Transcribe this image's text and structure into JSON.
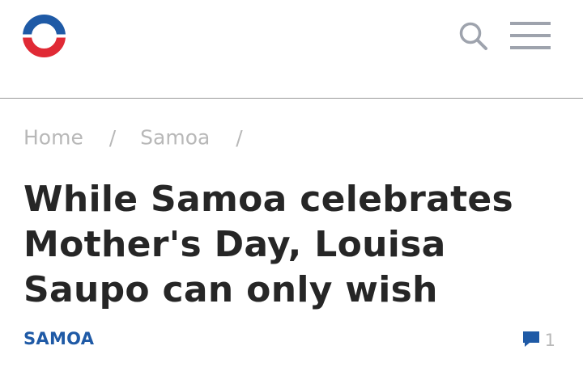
{
  "header": {
    "logo_icon": "circle-logo-icon",
    "search_icon": "search-icon",
    "menu_icon": "hamburger-menu-icon"
  },
  "breadcrumb": {
    "items": [
      "Home",
      "Samoa"
    ],
    "separator": "/"
  },
  "article": {
    "title": "While Samoa celebrates Mother's Day, Louisa Saupo can only wish",
    "category": "SAMOA",
    "comment_icon": "comment-bubble-icon",
    "comment_count": "1"
  },
  "colors": {
    "logo_blue": "#1f5aa6",
    "logo_red": "#e02a35",
    "accent_blue": "#1f5aa6",
    "title_text": "#262626",
    "muted_text": "#b8b8b8",
    "icon_gray": "#9ea3ad"
  }
}
